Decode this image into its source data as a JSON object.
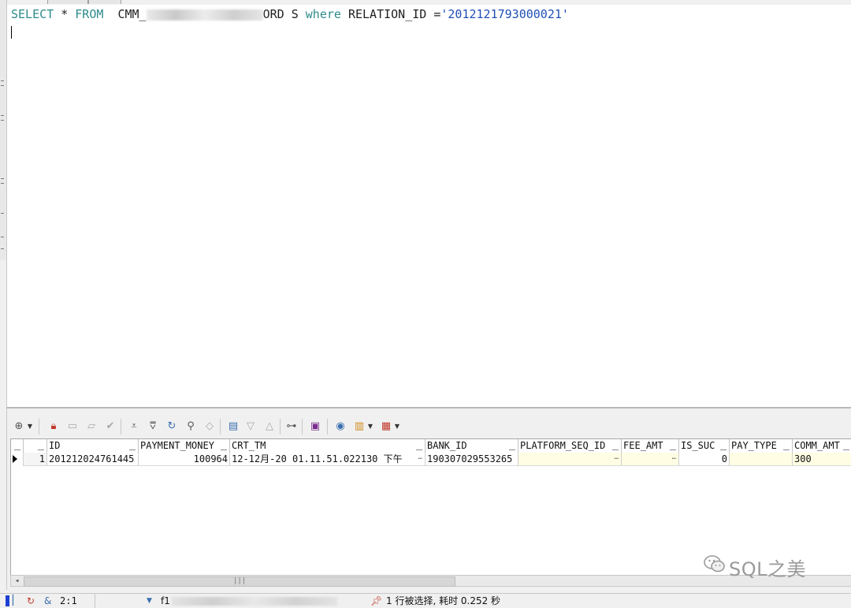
{
  "editor": {
    "sql": {
      "kw_select": "SELECT",
      "star": " * ",
      "kw_from": "FROM",
      "table_prefix": "  CMM_",
      "table_suffix": "ORD S ",
      "kw_where": "where",
      "condition": " RELATION_ID =",
      "value": "'2012121793000021'"
    }
  },
  "results": {
    "columns": [
      "ID",
      "PAYMENT_MONEY",
      "CRT_TM",
      "BANK_ID",
      "PLATFORM_SEQ_ID",
      "FEE_AMT",
      "IS_SUC",
      "PAY_TYPE",
      "COMM_AMT"
    ],
    "rows": [
      {
        "row_num": "1",
        "cells": [
          "201212024761445",
          "100964",
          "12-12月-20 01.11.51.022130 下午",
          "190307029553265",
          "",
          "",
          "0",
          "",
          "300"
        ]
      }
    ]
  },
  "status": {
    "cursor": "2:1",
    "connection_prefix": "f1",
    "message": "1 行被选择, 耗时 0.252 秒"
  },
  "watermark": {
    "text": "SQL之美"
  },
  "colors": {
    "keyword": "#2e8b8b",
    "string": "#1f4fb8",
    "highlight_cell": "#fffde3"
  }
}
